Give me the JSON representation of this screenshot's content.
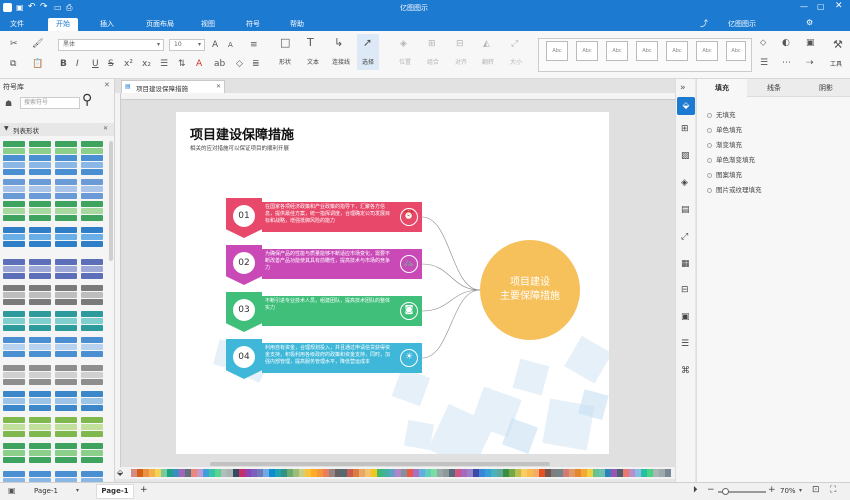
{
  "app": {
    "title": "亿图图示",
    "user": "亿图图示"
  },
  "menu": [
    "文件",
    "开始",
    "插入",
    "页面布局",
    "视图",
    "符号",
    "帮助"
  ],
  "ribbon": {
    "font_family": "黑体",
    "font_size": "10",
    "tools": [
      "形状",
      "文本",
      "连接线",
      "选择"
    ],
    "arrange": [
      "位置",
      "组合",
      "对齐",
      "翻转",
      "大小"
    ],
    "style_label": "Abc",
    "tools_label": "工具"
  },
  "library": {
    "title": "符号库",
    "search_placeholder": "搜索符号",
    "section": "列表形状"
  },
  "document": {
    "tab": "项目建设保障措施",
    "title": "项目建设保障措施",
    "subtitle": "相关的应对措施可以保证项目的顺利开展",
    "center_line1": "项目建设",
    "center_line2": "主要保障措施",
    "steps": [
      {
        "num": "01",
        "text": "在国家各项经济政策和产业政策的指导下，汇聚各方信息，提供最佳方案，统一指挥调度，合理确定公司发展目标和战略，增强抵御风险的能力",
        "color": "#e8496b",
        "icon": "alarm-clock-icon"
      },
      {
        "num": "02",
        "text": "为确保产品的性能与质量能够不断适应市场变化，需要不断改善产品功能使其具有前瞻性，提高技术与市场的竞争力",
        "color": "#c94ab7",
        "icon": "bicycle-icon"
      },
      {
        "num": "03",
        "text": "不断引进专业技术人员，组建团队，提高技术团队的整体实力",
        "color": "#3fbf7a",
        "icon": "camera-icon"
      },
      {
        "num": "04",
        "text": "利用自有资金，合理规划投入，并且通过申请信贷获得资金支持，积极利用各级政府的政策和资金支持，同时，加强内部管理，提高服务管理水平，降低营运成本",
        "color": "#3fb7d9",
        "icon": "lightbulb-icon"
      }
    ]
  },
  "right_panel": {
    "tabs": [
      "填充",
      "线条",
      "阴影"
    ],
    "options": [
      "无填充",
      "单色填充",
      "渐变填充",
      "单色渐变填充",
      "图案填充",
      "图片或纹理填充"
    ]
  },
  "status": {
    "page_selector": "Page-1",
    "page_tab": "Page-1",
    "add": "+",
    "zoom": "70%"
  }
}
